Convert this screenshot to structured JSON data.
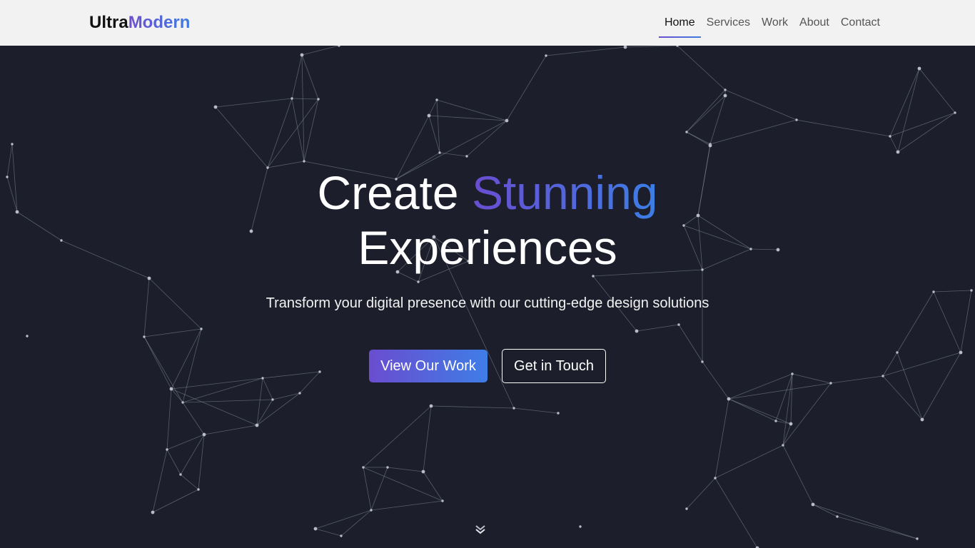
{
  "brand": {
    "part1": "Ultra",
    "part2": "Modern"
  },
  "nav": {
    "items": [
      {
        "label": "Home",
        "active": true
      },
      {
        "label": "Services",
        "active": false
      },
      {
        "label": "Work",
        "active": false
      },
      {
        "label": "About",
        "active": false
      },
      {
        "label": "Contact",
        "active": false
      }
    ]
  },
  "hero": {
    "title_word1": "Create",
    "title_word2": "Stunning",
    "title_line2": "Experiences",
    "subtitle": "Transform your digital presence with our cutting-edge design solutions",
    "primary_button": "View Our Work",
    "secondary_button": "Get in Touch",
    "scroll_icon": "chevron-double-down-icon"
  },
  "colors": {
    "nav_background": "#f2f2f2",
    "hero_background": "#1c1f2b",
    "gradient_start": "#6a4dd0",
    "gradient_end": "#3f7de6",
    "network_line": "#8a8f9c",
    "network_node": "#b9bcc6"
  }
}
